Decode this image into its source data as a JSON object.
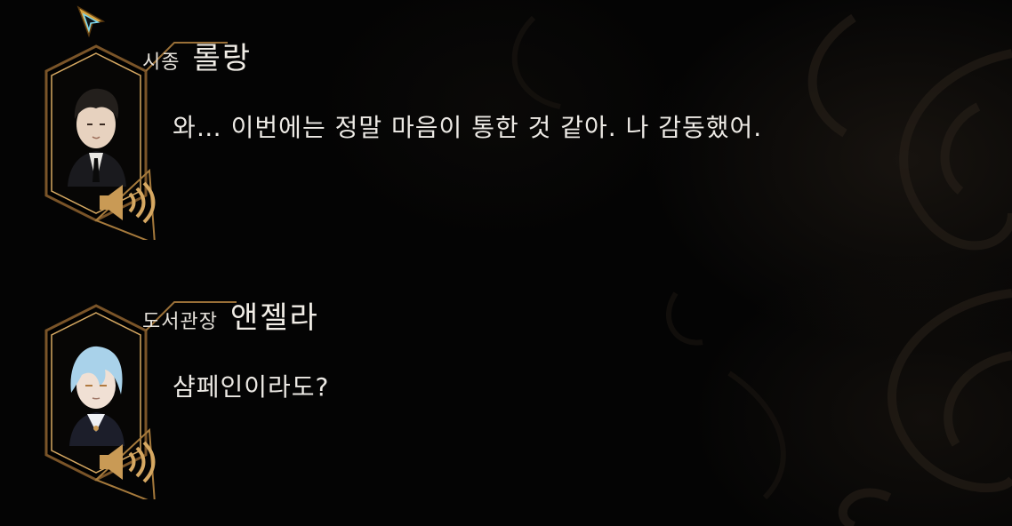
{
  "colors": {
    "frame_gold": "#c99a55",
    "frame_glow": "#8a6230",
    "text": "#ece9e4",
    "background": "#040404"
  },
  "icons": {
    "cursor": "cursor-arrow-icon",
    "voice": "speaker-icon"
  },
  "log": [
    {
      "title": "시종",
      "name": "롤랑",
      "line": "와… 이번에는 정말 마음이 통한 것 같아. 나 감동했어."
    },
    {
      "title": "도서관장",
      "name": "앤젤라",
      "line": "샴페인이라도?"
    }
  ]
}
